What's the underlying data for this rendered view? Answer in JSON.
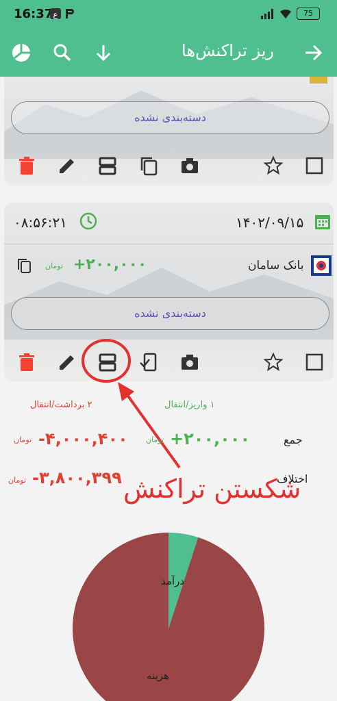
{
  "status_bar": {
    "time": "16:37",
    "battery": "75"
  },
  "app_bar": {
    "title": "ریز تراکنش‌ها"
  },
  "card1": {
    "category_pill": "دسته‌بندی نشده"
  },
  "card2": {
    "time": "۰۸:۵۶:۲۱",
    "date": "۱۴۰۲/۰۹/۱۵",
    "bank_name": "بانک سامان",
    "amount": "+۲۰۰,۰۰۰",
    "currency": "تومان",
    "category_pill": "دسته‌بندی نشده"
  },
  "summary": {
    "deposit_label": "۱ واریز/انتقال",
    "withdraw_label": "۲ برداشت/انتقال",
    "total_label": "جمع",
    "diff_label": "اختلاف",
    "deposit_total": "+۲۰۰,۰۰۰",
    "withdraw_total": "-۴,۰۰۰,۴۰۰",
    "diff_total": "-۳,۸۰۰,۳۹۹",
    "currency": "تومان"
  },
  "annotation": {
    "text": "شکستن تراکنش"
  },
  "pie": {
    "income_label": "درآمد",
    "expense_label": "هزینه",
    "income_fraction": 0.05,
    "colors": {
      "income": "#4fbf90",
      "expense": "#9a4646"
    }
  },
  "colors": {
    "accent": "#4fbf90",
    "delete": "#f44336",
    "annotation": "#e53030"
  }
}
